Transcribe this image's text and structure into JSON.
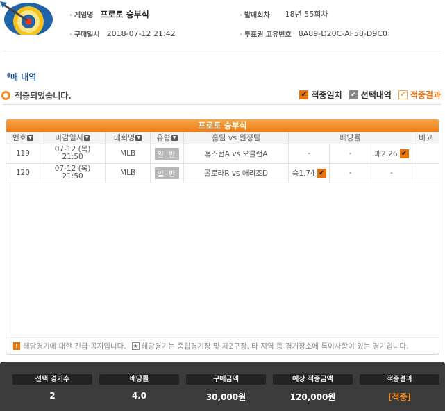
{
  "header": {
    "game_label": "게임명",
    "game_value": "프로토 승부식",
    "purchase_label": "구매일시",
    "purchase_value": "2018-07-12 21:42",
    "round_label": "발매회차",
    "round_value": "18년 55회차",
    "ticket_label": "투표권 고유번호",
    "ticket_value": "8A89-D20C-AF58-D9C0"
  },
  "section": {
    "title": "ᆥ매 내역",
    "status": "적중되었습니다."
  },
  "legend": {
    "match": "적중일치",
    "selected": "선택내역",
    "result": "적중결과"
  },
  "table": {
    "title": "프로토 승부식",
    "columns": [
      "번호",
      "마감일시",
      "대회명",
      "유형",
      "홈팀 vs 원정팀",
      "배당률",
      "비고"
    ],
    "rows": [
      {
        "num": "119",
        "date": "07-12 (목)",
        "time": "21:50",
        "league": "MLB",
        "type": "일 반",
        "teams": "휴스턴A vs 오클랜A",
        "odd1": "-",
        "odd2": "-",
        "odd3": "패2.26"
      },
      {
        "num": "120",
        "date": "07-12 (목)",
        "time": "21:50",
        "league": "MLB",
        "type": "일 반",
        "teams": "콜로라R vs 애리조D",
        "odd1": "승1.74",
        "odd2": "-",
        "odd3": "-"
      }
    ],
    "notice1": "해당경기에 대한 긴급 공지입니다.",
    "notice2": "해당경기는 중립경기장 및 제2구장, 타 지역 등 경기장소에 특이사항이 있는 경기입니다."
  },
  "summary": {
    "items": [
      {
        "label": "선택 경기수",
        "value": "2"
      },
      {
        "label": "배당률",
        "value": "4.0"
      },
      {
        "label": "구매금액",
        "value": "30,000원"
      },
      {
        "label": "예상 적중금액",
        "value": "120,000원"
      },
      {
        "label": "적중결과",
        "value": "[적중]"
      }
    ]
  },
  "colors": {
    "accent": "#e8720c",
    "title_blue": "#1a4a82",
    "summary_bg": "#3b3b3b"
  },
  "icons": {
    "logo": "dart-target-icon",
    "check": "check-icon",
    "sort": "sort-icon",
    "warn": "warning-icon",
    "star": "star-icon"
  }
}
